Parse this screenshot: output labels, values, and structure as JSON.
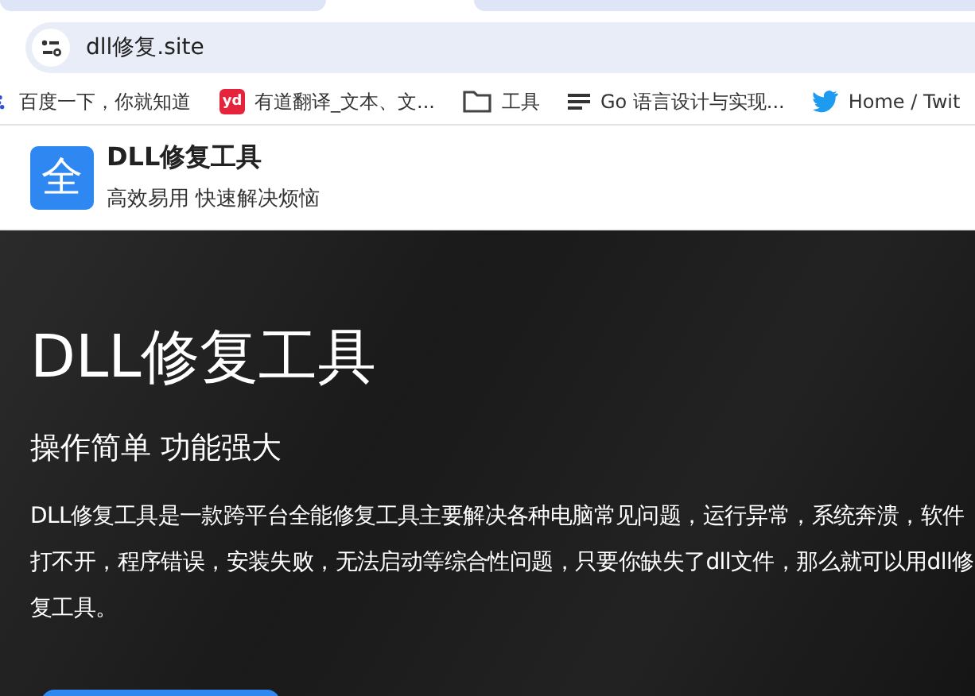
{
  "address_bar": {
    "url": "dll修复.site"
  },
  "bookmarks": [
    {
      "kind": "paw",
      "label": "百度一下，你就知道"
    },
    {
      "kind": "yd",
      "label": "有道翻译_文本、文...",
      "icon_text": "yd"
    },
    {
      "kind": "folder",
      "label": "工具"
    },
    {
      "kind": "lines",
      "label": "Go 语言设计与实现..."
    },
    {
      "kind": "bird",
      "label": "Home / Twit"
    }
  ],
  "site_header": {
    "logo_text": "全",
    "title": "DLL修复工具",
    "tagline": "高效易用 快速解决烦恼"
  },
  "hero": {
    "title": "DLL修复工具",
    "subtitle": "操作简单 功能强大",
    "description": "DLL修复工具是一款跨平台全能修复工具主要解决各种电脑常见问题，运行异常，系统奔溃，软件打不开，程序错误，安装失败，无法启动等综合性问题，只要你缺失了dll文件，那么就可以用dll修复工具。"
  }
}
